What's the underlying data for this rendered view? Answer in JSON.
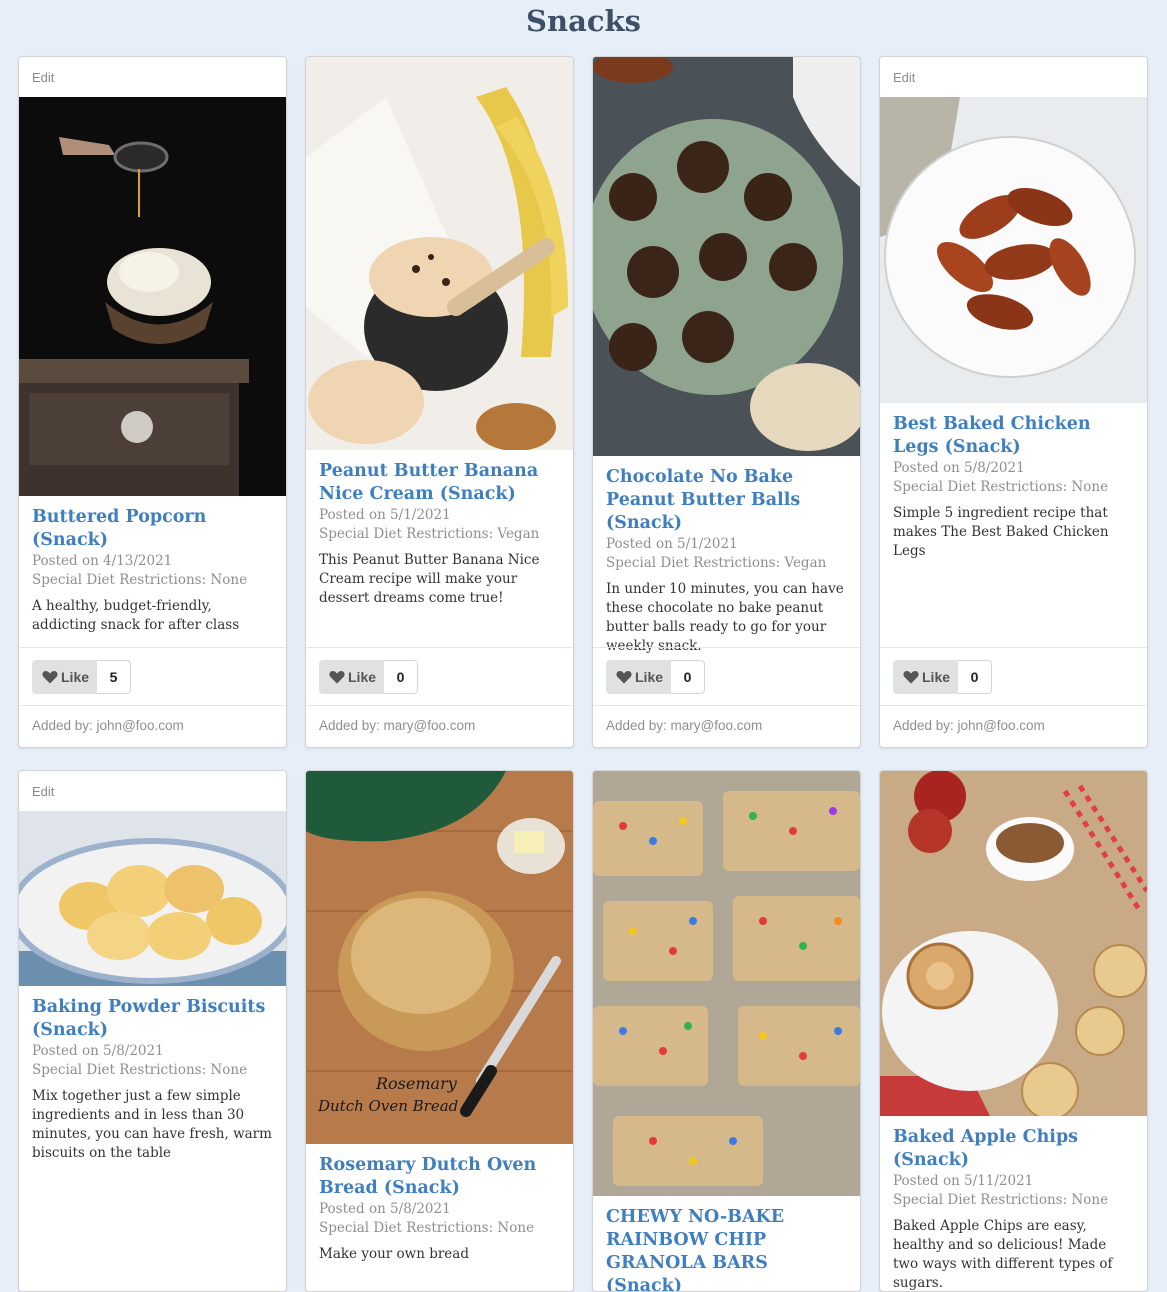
{
  "page": {
    "title": "Snacks"
  },
  "labels": {
    "edit": "Edit",
    "like": "Like"
  },
  "recipes": [
    {
      "title": "Buttered Popcorn (Snack)",
      "posted": "Posted on 4/13/2021",
      "diet": "Special Diet Restrictions: None",
      "description": "A healthy, budget-friendly, addicting snack for after class",
      "likes": "5",
      "added_by": "Added by: john@foo.com",
      "image": "popcorn"
    },
    {
      "title": "Peanut Butter Banana Nice Cream (Snack)",
      "posted": "Posted on 5/1/2021",
      "diet": "Special Diet Restrictions: Vegan",
      "description": "This Peanut Butter Banana Nice Cream recipe will make your dessert dreams come true!",
      "likes": "0",
      "added_by": "Added by: mary@foo.com",
      "image": "nice-cream"
    },
    {
      "title": "Chocolate No Bake Peanut Butter Balls (Snack)",
      "posted": "Posted on 5/1/2021",
      "diet": "Special Diet Restrictions: Vegan",
      "description": "In under 10 minutes, you can have these chocolate no bake peanut butter balls ready to go for your weekly snack.",
      "likes": "0",
      "added_by": "Added by: mary@foo.com",
      "image": "chocolate-balls"
    },
    {
      "title": "Best Baked Chicken Legs (Snack)",
      "posted": "Posted on 5/8/2021",
      "diet": "Special Diet Restrictions: None",
      "description": "Simple 5 ingredient recipe that makes The Best Baked Chicken Legs",
      "likes": "0",
      "added_by": "Added by: john@foo.com",
      "image": "chicken-legs"
    },
    {
      "title": "Baking Powder Biscuits (Snack)",
      "posted": "Posted on 5/8/2021",
      "diet": "Special Diet Restrictions: None",
      "description": "Mix together just a few simple ingredients and in less than 30 minutes, you can have fresh, warm biscuits on the table",
      "image": "biscuits"
    },
    {
      "title": "Rosemary Dutch Oven Bread (Snack)",
      "posted": "Posted on 5/8/2021",
      "diet": "Special Diet Restrictions: None",
      "description": "Make your own bread",
      "image": "bread",
      "image_caption_1": "Rosemary",
      "image_caption_2": "Dutch Oven Bread"
    },
    {
      "title": "CHEWY NO-BAKE RAINBOW CHIP GRANOLA BARS (Snack)",
      "image": "granola-bars"
    },
    {
      "title": "Baked Apple Chips (Snack)",
      "posted": "Posted on 5/11/2021",
      "diet": "Special Diet Restrictions: None",
      "description": "Baked Apple Chips are easy, healthy and so delicious! Made two ways with different types of sugars.",
      "image": "apple-chips"
    }
  ],
  "colors": {
    "background": "#e6eef8",
    "title_link": "#3f7fbf",
    "heading": "#3d5166"
  }
}
